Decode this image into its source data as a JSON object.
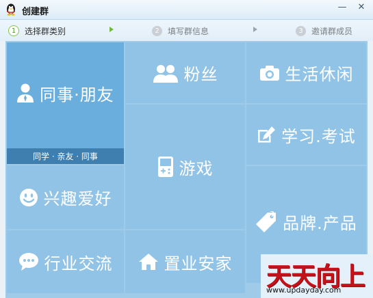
{
  "window": {
    "title": "创建群",
    "minimize_glyph": "—",
    "close_glyph": "✕",
    "app_icon": "qq-penguin-icon"
  },
  "steps": [
    {
      "num": "1",
      "label": "选择群类别",
      "state": "active"
    },
    {
      "num": "2",
      "label": "填写群信息",
      "state": "inactive"
    },
    {
      "num": "3",
      "label": "邀请群成员",
      "state": "inactive"
    }
  ],
  "categories": {
    "colleagues": {
      "label": "同事·朋友",
      "subcaption": "同学 · 亲友 · 同事",
      "icon": "person-icon",
      "selected": true
    },
    "fans": {
      "label": "粉丝",
      "icon": "people-icon"
    },
    "life": {
      "label": "生活休闲",
      "icon": "camera-icon"
    },
    "study": {
      "label": "学习.考试",
      "icon": "pencil-edit-icon"
    },
    "games": {
      "label": "游戏",
      "icon": "gamepad-icon"
    },
    "hobbies": {
      "label": "兴趣爱好",
      "icon": "smiley-icon"
    },
    "brands": {
      "label": "品牌.产品",
      "icon": "tag-icon"
    },
    "industry": {
      "label": "行业交流",
      "icon": "chat-bubble-icon"
    },
    "realestate": {
      "label": "置业安家",
      "icon": "house-icon"
    }
  },
  "watermark": {
    "big": "天天向上",
    "small": "www.updayday.com"
  },
  "colors": {
    "tile": "#90c3e6",
    "tile_selected": "#6aaede",
    "caption_bar": "#3f7fb0",
    "step_active": "#7ec44c",
    "watermark_red": "#c4121a"
  }
}
